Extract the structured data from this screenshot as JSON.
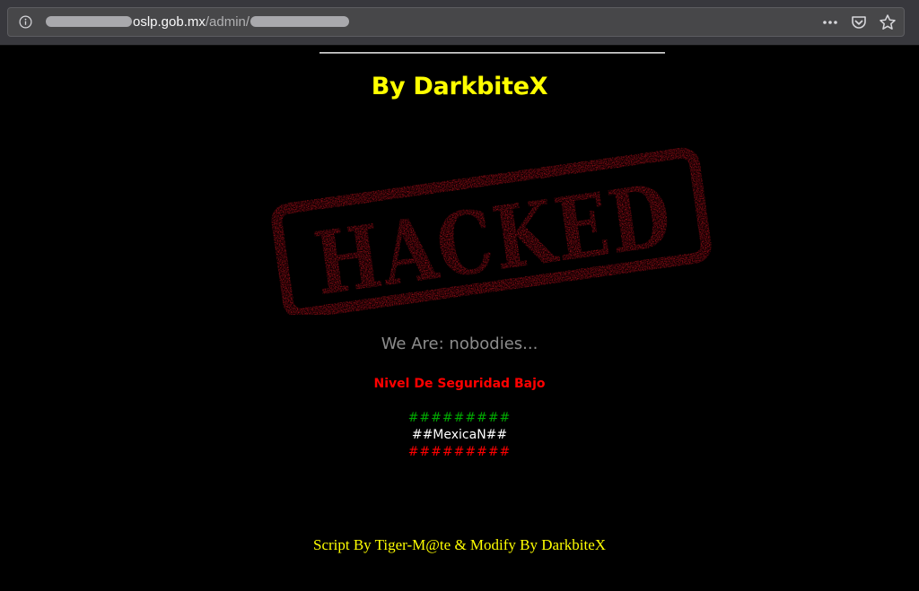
{
  "browser": {
    "url_host_suffix": "oslp.gob.mx",
    "url_path": "/admin/",
    "icons": [
      "info-icon",
      "page-actions-icon",
      "pocket-icon",
      "bookmark-star-icon"
    ]
  },
  "page": {
    "byline": "By DarkbiteX",
    "stamp_text": "HACKED",
    "we_are": "We Are: nobodies...",
    "security_level": "Nivel De Seguridad Bajo",
    "hash_top": "#########",
    "group_name": "##MexicaN##",
    "hash_bottom": "#########",
    "credits": "Script By Tiger-M@te & Modify By DarkbiteX"
  },
  "colors": {
    "background": "#000000",
    "byline": "#ffff00",
    "stamp": "#c4101c",
    "we_are": "#8c8c8c",
    "security": "#ff0000",
    "hash_top": "#00aa00",
    "group_name": "#ffffff",
    "hash_bottom": "#ff0000",
    "credits": "#ffff00"
  }
}
